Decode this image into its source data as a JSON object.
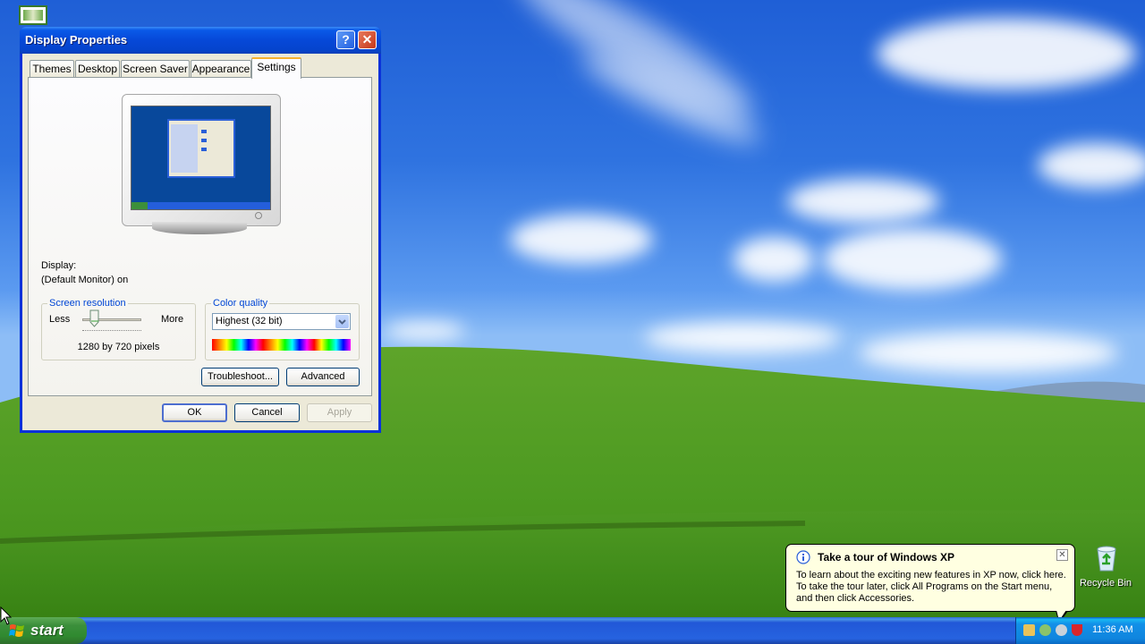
{
  "window": {
    "title": "Display Properties",
    "help_label": "?",
    "close_label": "✕"
  },
  "tabs": [
    {
      "label": "Themes"
    },
    {
      "label": "Desktop"
    },
    {
      "label": "Screen Saver"
    },
    {
      "label": "Appearance"
    },
    {
      "label": "Settings",
      "active": true
    }
  ],
  "settings": {
    "display_label": "Display:",
    "display_value": "(Default Monitor) on",
    "resolution_group": "Screen resolution",
    "less_label": "Less",
    "more_label": "More",
    "resolution_value": "1280 by 720 pixels",
    "resolution_slider_level": 0.2,
    "color_group": "Color quality",
    "color_selected": "Highest (32 bit)",
    "troubleshoot_label": "Troubleshoot...",
    "advanced_label": "Advanced"
  },
  "buttons": {
    "ok": "OK",
    "cancel": "Cancel",
    "apply": "Apply"
  },
  "desktop": {
    "recycle_bin_label": "Recycle Bin"
  },
  "taskbar": {
    "start_label": "start",
    "clock": "11:36 AM"
  },
  "balloon": {
    "title": "Take a tour of Windows XP",
    "lines": [
      "To learn about the exciting new features in XP now, click here.",
      "To take the tour later, click All Programs on the Start menu,",
      "and then click Accessories."
    ],
    "close_label": "✕"
  },
  "colors": {
    "titlebar": "#0548d8",
    "taskbar": "#245edb",
    "start": "#3c8f3b",
    "balloon": "#ffffe1",
    "group_title": "#0046d5"
  },
  "icons": [
    "app-icon",
    "help-icon",
    "close-icon",
    "windows-flag-icon",
    "recycle-bin-icon",
    "info-icon",
    "tray-icons",
    "mouse-cursor-icon",
    "dropdown-arrow-icon",
    "slider-thumb-icon"
  ]
}
